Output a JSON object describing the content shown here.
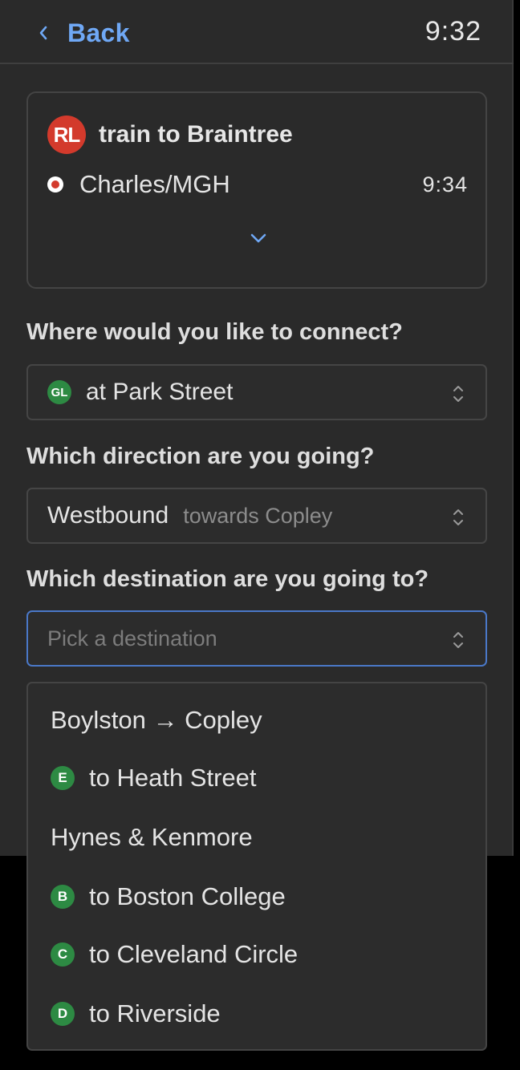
{
  "header": {
    "back_label": "Back",
    "time": "9:32"
  },
  "trip": {
    "route_badge": "RL",
    "route_title": "train to Braintree",
    "stop_name": "Charles/MGH",
    "stop_time": "9:34"
  },
  "connect": {
    "question": "Where would you like to connect?",
    "badge": "GL",
    "value": "at Park Street"
  },
  "direction": {
    "question": "Which direction are you going?",
    "value": "Westbound",
    "sub": "towards Copley"
  },
  "destination": {
    "question": "Which destination are you going to?",
    "placeholder": "Pick a destination"
  },
  "menu": {
    "items": [
      {
        "kind": "group",
        "label": "Boylston → Copley"
      },
      {
        "kind": "option",
        "badge": "E",
        "label": "to Heath Street"
      },
      {
        "kind": "group",
        "label": "Hynes & Kenmore"
      },
      {
        "kind": "option",
        "badge": "B",
        "label": "to Boston College"
      },
      {
        "kind": "option",
        "badge": "C",
        "label": "to Cleveland Circle"
      },
      {
        "kind": "option",
        "badge": "D",
        "label": "to Riverside"
      }
    ]
  },
  "colors": {
    "accent": "#6fa8f5",
    "red_line": "#d33a2c",
    "green_line": "#2d8a43",
    "focus": "#4a78c8"
  },
  "icons": {
    "back": "chevron-left-icon",
    "expand": "chevron-down-icon",
    "select": "up-down-arrows-icon"
  }
}
